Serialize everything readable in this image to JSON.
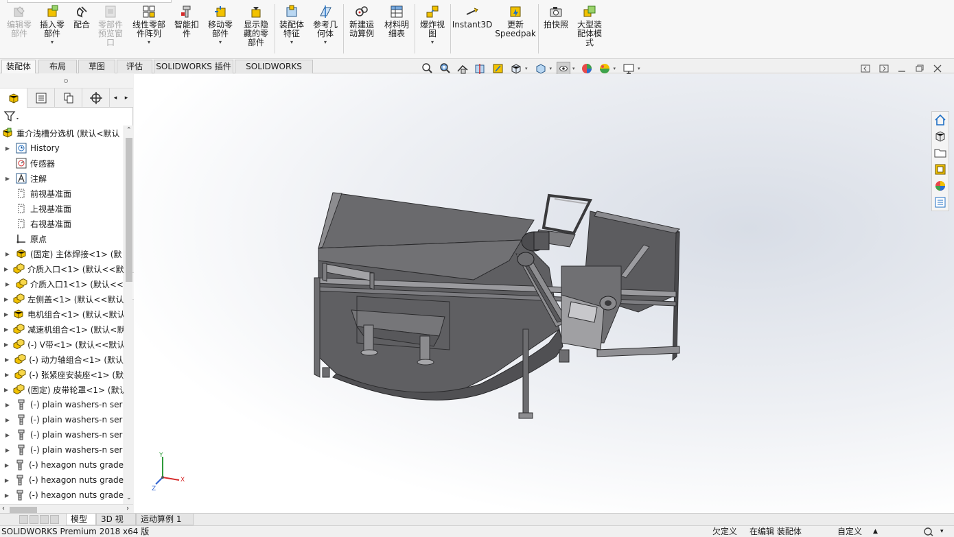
{
  "ribbon": {
    "buttons": [
      {
        "id": "edit-component",
        "label": "编辑零\n部件",
        "icon": "edit-component-icon",
        "disabled": true,
        "dropdown": false
      },
      {
        "id": "insert-components",
        "label": "插入零\n部件",
        "icon": "insert-components-icon",
        "disabled": false,
        "dropdown": true
      },
      {
        "id": "mate",
        "label": "配合",
        "icon": "mate-icon",
        "disabled": false,
        "dropdown": false
      },
      {
        "id": "component-preview",
        "label": "零部件\n预览窗\n口",
        "icon": "component-preview-icon",
        "disabled": true,
        "dropdown": false
      },
      {
        "id": "linear-pattern",
        "label": "线性零部\n件阵列",
        "icon": "linear-pattern-icon",
        "disabled": false,
        "dropdown": true
      },
      {
        "id": "smart-fasteners",
        "label": "智能扣\n件",
        "icon": "smart-fasteners-icon",
        "disabled": false,
        "dropdown": false
      },
      {
        "id": "move-component",
        "label": "移动零\n部件",
        "icon": "move-component-icon",
        "disabled": false,
        "dropdown": true
      },
      {
        "id": "show-hidden",
        "label": "显示隐\n藏的零\n部件",
        "icon": "show-hidden-icon",
        "disabled": false,
        "dropdown": false
      },
      {
        "id": "assembly-features",
        "label": "装配体\n特征",
        "icon": "assembly-features-icon",
        "disabled": false,
        "dropdown": true
      },
      {
        "id": "reference-geometry",
        "label": "参考几\n何体",
        "icon": "reference-geometry-icon",
        "disabled": false,
        "dropdown": true
      },
      {
        "id": "new-motion-study",
        "label": "新建运\n动算例",
        "icon": "motion-study-icon",
        "disabled": false,
        "dropdown": false
      },
      {
        "id": "bill-of-materials",
        "label": "材料明\n细表",
        "icon": "bom-icon",
        "disabled": false,
        "dropdown": false
      },
      {
        "id": "exploded-view",
        "label": "爆炸视\n图",
        "icon": "exploded-view-icon",
        "disabled": false,
        "dropdown": true
      },
      {
        "id": "instant3d",
        "label": "Instant3D",
        "icon": "instant3d-icon",
        "disabled": false,
        "dropdown": false
      },
      {
        "id": "update-speedpak",
        "label": "更新\nSpeedpak",
        "icon": "speedpak-icon",
        "disabled": false,
        "dropdown": false
      },
      {
        "id": "take-snapshot",
        "label": "拍快照",
        "icon": "camera-icon",
        "disabled": false,
        "dropdown": false
      },
      {
        "id": "large-assembly-mode",
        "label": "大型装\n配体模\n式",
        "icon": "large-assembly-icon",
        "disabled": false,
        "dropdown": false
      }
    ]
  },
  "command_tabs": [
    "装配体",
    "布局",
    "草图",
    "评估",
    "SOLIDWORKS 插件",
    "SOLIDWORKS MBD"
  ],
  "active_command_tab": 0,
  "heads_up_toolbar": [
    "zoom-to-fit-icon",
    "zoom-to-area-icon",
    "previous-view-icon",
    "section-view-icon",
    "dynamic-annotation-icon",
    "view-orientation-icon",
    "display-style-icon",
    "hide-show-icon",
    "edit-appearance-icon",
    "apply-scene-icon",
    "view-settings-icon"
  ],
  "panel_tabs": [
    "feature-manager-icon",
    "property-manager-icon",
    "configuration-manager-icon",
    "dimxpert-icon"
  ],
  "tree": {
    "root": "重介浅槽分选机  (默认<默认",
    "items": [
      {
        "label": "History",
        "icon": "history-icon",
        "expandable": true
      },
      {
        "label": "传感器",
        "icon": "sensor-icon",
        "expandable": false
      },
      {
        "label": "注解",
        "icon": "annotation-icon",
        "expandable": true
      },
      {
        "label": "前视基准面",
        "icon": "plane-icon",
        "expandable": false
      },
      {
        "label": "上视基准面",
        "icon": "plane-icon",
        "expandable": false
      },
      {
        "label": "右视基准面",
        "icon": "plane-icon",
        "expandable": false
      },
      {
        "label": "原点",
        "icon": "origin-icon",
        "expandable": false
      },
      {
        "label": "(固定) 主体焊接<1> (默",
        "icon": "part-icon",
        "expandable": true
      },
      {
        "label": "介质入口<1> (默认<<默",
        "icon": "subassembly-icon",
        "expandable": true
      },
      {
        "label": "介质入口1<1> (默认<<",
        "icon": "subassembly-icon",
        "expandable": true
      },
      {
        "label": "左侧盖<1> (默认<<默认",
        "icon": "subassembly-icon",
        "expandable": true
      },
      {
        "label": "电机组合<1> (默认<默认",
        "icon": "part-icon",
        "expandable": true
      },
      {
        "label": "减速机组合<1> (默认<默",
        "icon": "subassembly-icon",
        "expandable": true
      },
      {
        "label": "(-) V带<1> (默认<<默认",
        "icon": "subassembly-icon",
        "expandable": true
      },
      {
        "label": "(-) 动力轴组合<1> (默认",
        "icon": "subassembly-icon",
        "expandable": true
      },
      {
        "label": "(-) 张紧座安装座<1> (默",
        "icon": "subassembly-icon",
        "expandable": true
      },
      {
        "label": "(固定) 皮带轮罩<1> (默认",
        "icon": "subassembly-icon",
        "expandable": true
      },
      {
        "label": "(-) plain washers-n ser",
        "icon": "fastener-icon",
        "expandable": true
      },
      {
        "label": "(-) plain washers-n ser",
        "icon": "fastener-icon",
        "expandable": true
      },
      {
        "label": "(-) plain washers-n ser",
        "icon": "fastener-icon",
        "expandable": true
      },
      {
        "label": "(-) plain washers-n ser",
        "icon": "fastener-icon",
        "expandable": true
      },
      {
        "label": "(-) hexagon nuts grade",
        "icon": "fastener-icon",
        "expandable": true
      },
      {
        "label": "(-) hexagon nuts grade",
        "icon": "fastener-icon",
        "expandable": true
      },
      {
        "label": "(-) hexagon nuts grade",
        "icon": "fastener-icon",
        "expandable": true
      }
    ]
  },
  "triad": {
    "x": "X",
    "y": "Y",
    "z": "Z"
  },
  "task_pane": [
    "solidworks-resources-icon",
    "design-library-icon",
    "file-explorer-icon",
    "view-palette-icon",
    "appearances-icon",
    "custom-properties-icon"
  ],
  "bottom_tabs": [
    "模型",
    "3D 视图",
    "运动算例 1"
  ],
  "active_bottom_tab": 0,
  "status": {
    "product": "SOLIDWORKS Premium 2018 x64 版",
    "definition": "欠定义",
    "editing": "在编辑 装配体",
    "units": "自定义"
  },
  "colors": {
    "accent": "#1f6fc5",
    "part_yellow": "#f2c200",
    "model_gray": "#5e5e60",
    "model_light": "#8d8d90"
  }
}
